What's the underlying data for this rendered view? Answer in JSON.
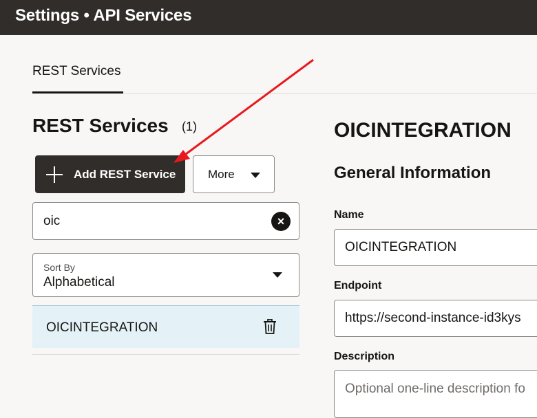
{
  "header": {
    "title": "Settings • API Services"
  },
  "tabs": [
    {
      "label": "REST Services"
    }
  ],
  "list": {
    "title": "REST Services",
    "count": "(1)",
    "add_button_label": "Add REST Service",
    "more_button_label": "More",
    "search_value": "oic",
    "sort_label": "Sort By",
    "sort_value": "Alphabetical",
    "items": [
      {
        "name": "OICINTEGRATION"
      }
    ]
  },
  "detail": {
    "title": "OICINTEGRATION",
    "section_title": "General Information",
    "name_label": "Name",
    "name_value": "OICINTEGRATION",
    "endpoint_label": "Endpoint",
    "endpoint_value": "https://second-instance-id3kys",
    "description_label": "Description",
    "description_placeholder": "Optional one-line description fo"
  },
  "colors": {
    "header_bg": "#312d2a",
    "selected_row_bg": "#e4f1f7",
    "annotation_arrow": "#e8191e"
  },
  "icons": [
    "plus-icon",
    "chevron-down-icon",
    "clear-icon",
    "trash-icon",
    "annotation-arrow"
  ]
}
